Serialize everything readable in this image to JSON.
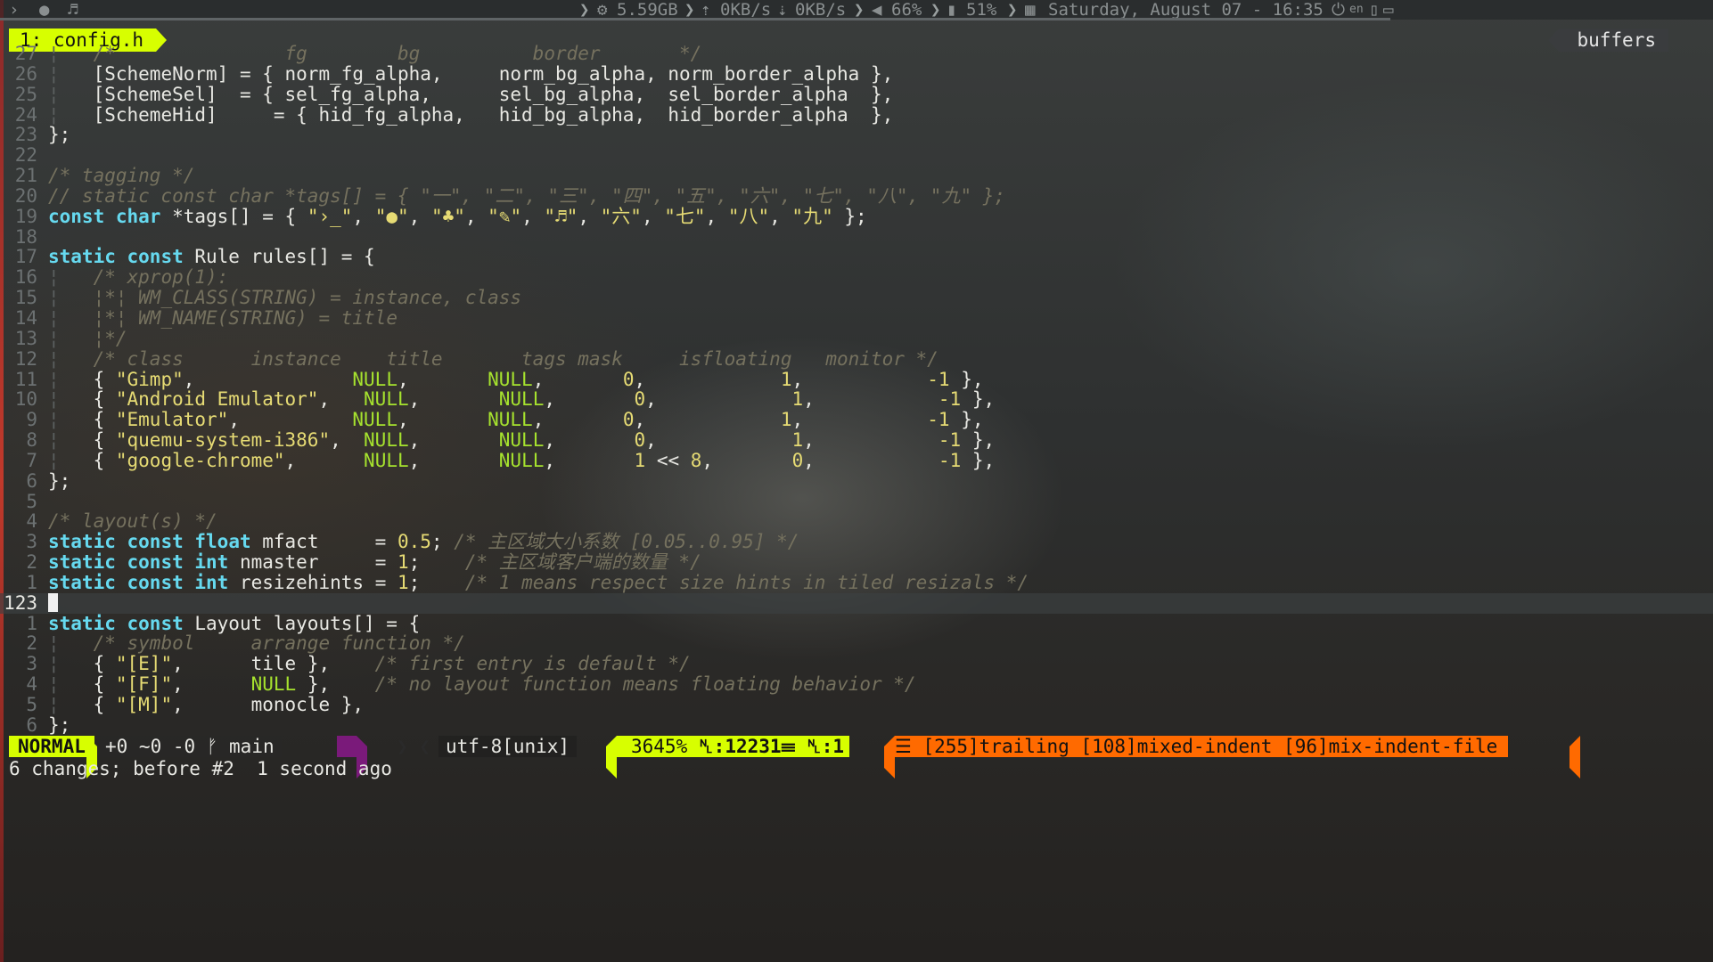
{
  "topbar": {
    "terminal_icon": "›_",
    "disk": "5.59GB",
    "net_up": "0KB/s",
    "net_down": "0KB/s",
    "volume": "66%",
    "battery": "51%",
    "datetime": "Saturday, August 07 - 16:35",
    "lang": "en"
  },
  "tabline": {
    "active_tab": "1: config.h",
    "buffers_label": "buffers"
  },
  "editor": {
    "lines": [
      {
        "ln": "27",
        "html": "<span class=\"g\">¦</span>   <span class=\"c\">/*               fg        bg          border       */</span>"
      },
      {
        "ln": "26",
        "html": "<span class=\"g\">¦</span>   [SchemeNorm] = { norm_fg_alpha,     norm_bg_alpha, norm_border_alpha },"
      },
      {
        "ln": "25",
        "html": "<span class=\"g\">¦</span>   [SchemeSel]  = { sel_fg_alpha,      sel_bg_alpha,  sel_border_alpha  },"
      },
      {
        "ln": "24",
        "html": "<span class=\"g\">¦</span>   [SchemeHid]     = { hid_fg_alpha,   hid_bg_alpha,  hid_border_alpha  },"
      },
      {
        "ln": "23",
        "html": "};"
      },
      {
        "ln": "22",
        "html": ""
      },
      {
        "ln": "21",
        "html": "<span class=\"c\">/* tagging */</span>"
      },
      {
        "ln": "20",
        "html": "<span class=\"c\">// static const char *tags[] = { \"一\", \"二\", \"三\", \"四\", \"五\", \"六\", \"七\", \"八\", \"九\" };</span>"
      },
      {
        "ln": "19",
        "html": "<span class=\"k\">const</span> <span class=\"k\">char</span> *tags[] = { <span class=\"s\">\"›_\"</span>, <span class=\"s\">\"●\"</span>, <span class=\"s\">\"♣\"</span>, <span class=\"s\">\"✎\"</span>, <span class=\"s\">\"♬\"</span>, <span class=\"s\">\"六\"</span>, <span class=\"s\">\"七\"</span>, <span class=\"s\">\"八\"</span>, <span class=\"s\">\"九\"</span> };"
      },
      {
        "ln": "18",
        "html": ""
      },
      {
        "ln": "17",
        "html": "<span class=\"k\">static</span> <span class=\"k\">const</span> Rule rules[] = {"
      },
      {
        "ln": "16",
        "html": "<span class=\"g\">¦</span>   <span class=\"c\">/* xprop(1):</span>"
      },
      {
        "ln": "15",
        "html": "<span class=\"g\">¦</span>   <span class=\"c\">¦*¦ WM_CLASS(STRING) = instance, class</span>"
      },
      {
        "ln": "14",
        "html": "<span class=\"g\">¦</span>   <span class=\"c\">¦*¦ WM_NAME(STRING) = title</span>"
      },
      {
        "ln": "13",
        "html": "<span class=\"g\">¦</span>   <span class=\"c\">¦*/</span>"
      },
      {
        "ln": "12",
        "html": "<span class=\"g\">¦</span>   <span class=\"c\">/* class      instance    title       tags mask     isfloating   monitor */</span>"
      },
      {
        "ln": "11",
        "html": "<span class=\"g\">¦</span>   { <span class=\"s\">\"Gimp\"</span>,              <span class=\"nl\">NULL</span>,       <span class=\"nl\">NULL</span>,       <span class=\"n\">0</span>,            <span class=\"n\">1</span>,           <span class=\"n\">-1</span> },"
      },
      {
        "ln": "10",
        "html": "<span class=\"g\">¦</span>   { <span class=\"s\">\"Android Emulator\"</span>,   <span class=\"nl\">NULL</span>,       <span class=\"nl\">NULL</span>,       <span class=\"n\">0</span>,            <span class=\"n\">1</span>,           <span class=\"n\">-1</span> },"
      },
      {
        "ln": "9",
        "html": "<span class=\"g\">¦</span>   { <span class=\"s\">\"Emulator\"</span>,          <span class=\"nl\">NULL</span>,       <span class=\"nl\">NULL</span>,       <span class=\"n\">0</span>,            <span class=\"n\">1</span>,           <span class=\"n\">-1</span> },"
      },
      {
        "ln": "8",
        "html": "<span class=\"g\">¦</span>   { <span class=\"s\">\"quemu-system-i386\"</span>,  <span class=\"nl\">NULL</span>,       <span class=\"nl\">NULL</span>,       <span class=\"n\">0</span>,            <span class=\"n\">1</span>,           <span class=\"n\">-1</span> },"
      },
      {
        "ln": "7",
        "html": "<span class=\"g\">¦</span>   { <span class=\"s\">\"google-chrome\"</span>,      <span class=\"nl\">NULL</span>,       <span class=\"nl\">NULL</span>,       <span class=\"n\">1</span> &lt;&lt; <span class=\"n\">8</span>,       <span class=\"n\">0</span>,           <span class=\"n\">-1</span> },"
      },
      {
        "ln": "6",
        "html": "};"
      },
      {
        "ln": "5",
        "html": ""
      },
      {
        "ln": "4",
        "html": "<span class=\"c\">/* layout(s) */</span>"
      },
      {
        "ln": "3",
        "html": "<span class=\"k\">static</span> <span class=\"k\">const</span> <span class=\"k\">float</span> mfact     = <span class=\"n\">0.5</span>; <span class=\"c\">/* 主区域大小系数 [0.05..0.95] */</span>"
      },
      {
        "ln": "2",
        "html": "<span class=\"k\">static</span> <span class=\"k\">const</span> <span class=\"k\">int</span> nmaster     = <span class=\"n\">1</span>;    <span class=\"c\">/* 主区域客户端的数量 */</span>"
      },
      {
        "ln": "1",
        "html": "<span class=\"k\">static</span> <span class=\"k\">const</span> <span class=\"k\">int</span> resizehints = <span class=\"n\">1</span>;    <span class=\"c\">/* 1 means respect size hints in tiled resizals */</span>"
      },
      {
        "ln": "123",
        "html": "<span class=\"cursor\"></span>",
        "current": true
      },
      {
        "ln": "1",
        "html": "<span class=\"k\">static</span> <span class=\"k\">const</span> Layout layouts[] = {"
      },
      {
        "ln": "2",
        "html": "<span class=\"g\">¦</span>   <span class=\"c\">/* symbol     arrange function */</span>"
      },
      {
        "ln": "3",
        "html": "<span class=\"g\">¦</span>   { <span class=\"s\">\"[E]\"</span>,      tile },    <span class=\"c\">/* first entry is default */</span>"
      },
      {
        "ln": "4",
        "html": "<span class=\"g\">¦</span>   { <span class=\"s\">\"[F]\"</span>,      <span class=\"nl\">NULL</span> },    <span class=\"c\">/* no layout function means floating behavior */</span>"
      },
      {
        "ln": "5",
        "html": "<span class=\"g\">¦</span>   { <span class=\"s\">\"[M]\"</span>,      monocle },"
      },
      {
        "ln": "6",
        "html": "};"
      }
    ]
  },
  "statusline": {
    "mode": "NORMAL",
    "git": "+0 ~0 -0 ᚠ main",
    "encoding": "utf-8[unix]",
    "percent": "3645%",
    "line_label": "␤:12231",
    "col_label": "☰ ␤:1",
    "warnings": "☰ [255]trailing [108]mixed-indent [96]mix-indent-file"
  },
  "cmdline": "6 changes; before #2  1 second ago"
}
